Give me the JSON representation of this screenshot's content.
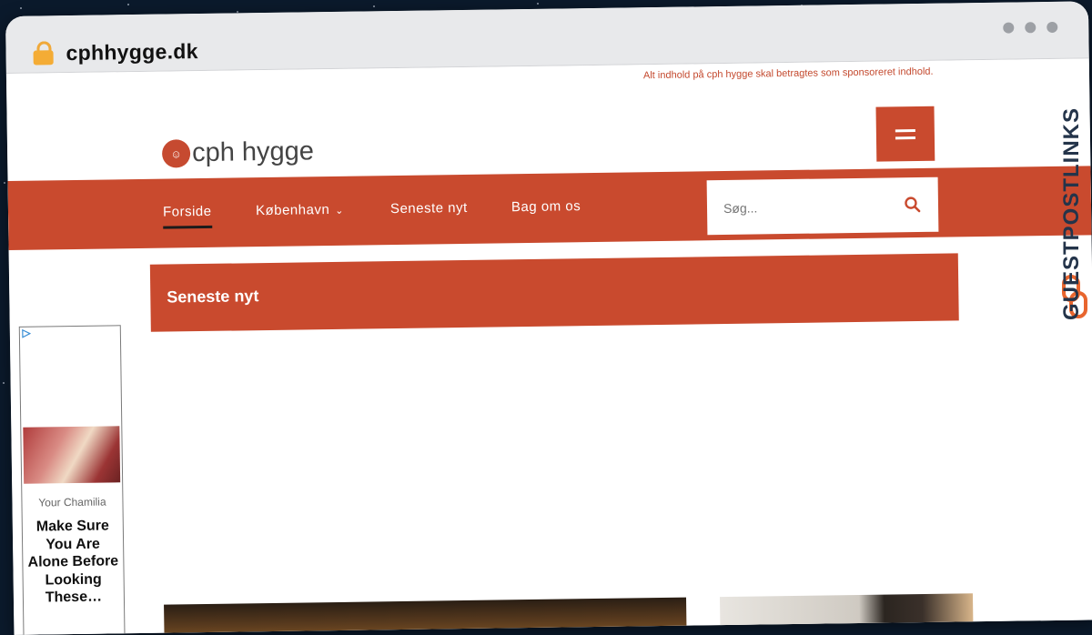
{
  "browser": {
    "url": "cphhygge.dk",
    "lock_icon": "lock-icon"
  },
  "site": {
    "disclaimer": "Alt indhold på cph hygge skal betragtes som sponsoreret indhold.",
    "logo_text": "cph hygge",
    "logo_mark": "☺",
    "menu_icon": "hamburger-icon"
  },
  "nav": {
    "items": [
      {
        "label": "Forside",
        "active": true
      },
      {
        "label": "København",
        "dropdown": true
      },
      {
        "label": "Seneste nyt"
      },
      {
        "label": "Bag om os"
      }
    ],
    "dropdown_chevron": "⌄"
  },
  "search": {
    "placeholder": "Søg...",
    "icon": "search-icon"
  },
  "section": {
    "title": "Seneste nyt"
  },
  "ad": {
    "source": "Your Chamilia",
    "headline": "Make Sure You Are Alone Before Looking These…"
  },
  "watermark": {
    "text": "GUESTPOSTLINKS"
  },
  "colors": {
    "accent": "#c94a2e",
    "background": "#0b1a2c"
  }
}
